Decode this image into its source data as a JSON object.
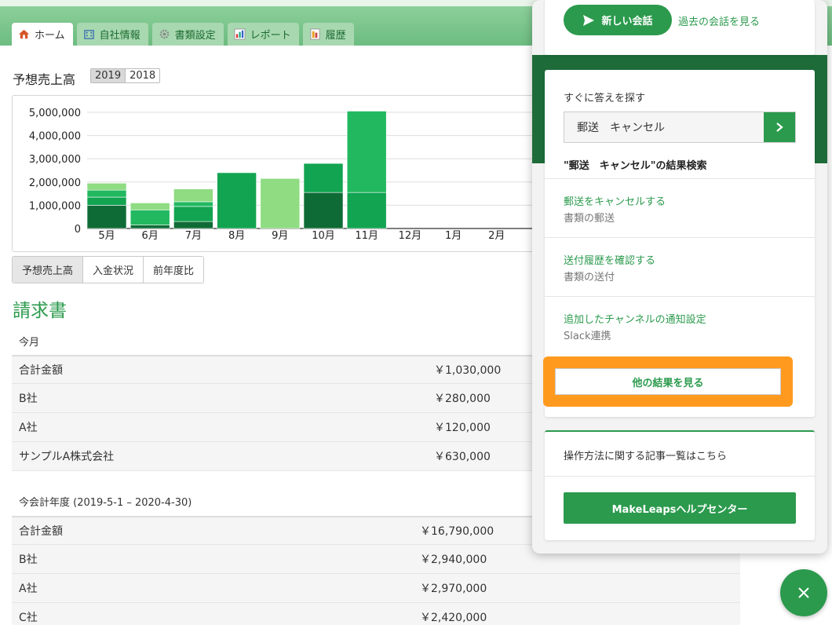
{
  "nav": {
    "tabs": [
      {
        "label": "ホーム",
        "icon": "home-icon",
        "active": true
      },
      {
        "label": "自社情報",
        "icon": "company-icon"
      },
      {
        "label": "書類設定",
        "icon": "gear-icon"
      },
      {
        "label": "レポート",
        "icon": "report-icon"
      },
      {
        "label": "履歴",
        "icon": "history-icon"
      }
    ]
  },
  "forecast": {
    "label": "予想売上高",
    "years": [
      "2019",
      "2018"
    ]
  },
  "chart_data": {
    "type": "bar",
    "stacked": true,
    "categories": [
      "5月",
      "6月",
      "7月",
      "8月",
      "9月",
      "10月",
      "11月",
      "12月",
      "1月",
      "2月"
    ],
    "yticks": [
      "5,000,000",
      "4,000,000",
      "3,000,000",
      "2,000,000",
      "1,000,000",
      "0"
    ],
    "ylim": [
      0,
      5000000
    ],
    "grid": true,
    "series": [
      {
        "color": "#0f6b36",
        "values": [
          1000000,
          150000,
          300000,
          0,
          0,
          1550000,
          0,
          0,
          0,
          0
        ]
      },
      {
        "color": "#12a451",
        "values": [
          350000,
          0,
          650000,
          2400000,
          0,
          1250000,
          1550000,
          0,
          0,
          0
        ]
      },
      {
        "color": "#22b860",
        "values": [
          300000,
          650000,
          200000,
          0,
          0,
          0,
          3500000,
          0,
          0,
          0
        ]
      },
      {
        "color": "#8fdc82",
        "values": [
          300000,
          300000,
          550000,
          0,
          2150000,
          0,
          0,
          0,
          0,
          0
        ]
      }
    ]
  },
  "view_toggle": [
    "予想売上高",
    "入金状況",
    "前年度比"
  ],
  "invoices": {
    "title": "請求書",
    "month_label": "今月",
    "month_rows": [
      {
        "name": "合計金額",
        "amount": "￥1,030,000"
      },
      {
        "name": "B社",
        "amount": "￥280,000"
      },
      {
        "name": "A社",
        "amount": "￥120,000"
      },
      {
        "name": "サンプルA株式会社",
        "amount": "￥630,000"
      }
    ],
    "fiscal_label": "今会計年度 (2019-5-1 – 2020-4-30)",
    "fiscal_rows": [
      {
        "name": "合計金額",
        "amount": "￥16,790,000"
      },
      {
        "name": "B社",
        "amount": "￥2,940,000"
      },
      {
        "name": "A社",
        "amount": "￥2,970,000"
      },
      {
        "name": "C社",
        "amount": "￥2,420,000"
      }
    ]
  },
  "help_widget": {
    "new_conversation": "新しい会話",
    "past_conversations": "過去の会話を見る",
    "search_heading": "すぐに答えを探す",
    "search_value": "郵送　キャンセル",
    "results_heading": "\"郵送　キャンセル\"の結果検索",
    "results": [
      {
        "title": "郵送をキャンセルする",
        "sub": "書類の郵送"
      },
      {
        "title": "送付履歴を確認する",
        "sub": "書類の送付"
      },
      {
        "title": "追加したチャンネルの通知設定",
        "sub": "Slack連携"
      }
    ],
    "more_results": "他の結果を見る",
    "help_title": "操作方法に関する記事一覧はこちら",
    "help_center": "MakeLeapsヘルプセンター"
  },
  "colors": {
    "brand_green": "#2b9a4d",
    "highlight_orange": "#ff9a1f"
  }
}
